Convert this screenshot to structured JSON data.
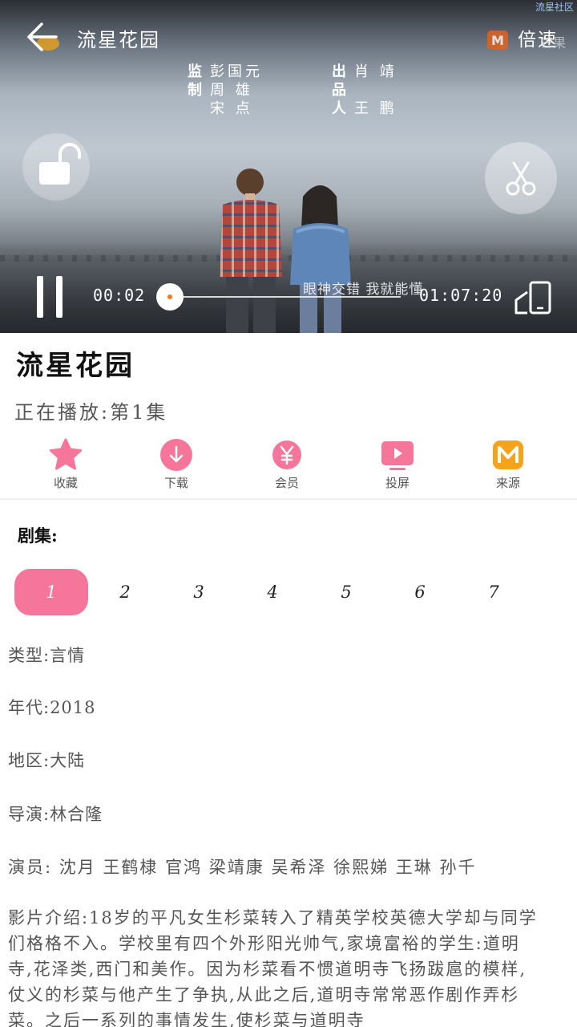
{
  "watermark": "流星社区",
  "player": {
    "title": "流星花园",
    "speed_label": "倍速",
    "logo_text": "芒果",
    "credits_left_role": [
      "监",
      "制"
    ],
    "credits_left_names": [
      "彭国元",
      "周  雄",
      "宋  点"
    ],
    "credits_right_role": [
      "出",
      "品",
      "人"
    ],
    "credits_right_names": [
      "肖  靖",
      "",
      "王  鹏"
    ],
    "current_time": "00:02",
    "total_time": "01:07:20",
    "subtitle": "眼神交错    我就能懂",
    "progress": 0
  },
  "show": {
    "title": "流星花园",
    "now_playing": "正在播放:第1集"
  },
  "actions": {
    "collect": "收藏",
    "download": "下载",
    "vip": "会员",
    "cast": "投屏",
    "source": "来源"
  },
  "episodes": {
    "label": "剧集:",
    "items": [
      "1",
      "2",
      "3",
      "4",
      "5",
      "6",
      "7"
    ],
    "active": "1"
  },
  "details": {
    "type": "类型:言情",
    "year": "年代:2018",
    "region": "地区:大陆",
    "director": "导演:林合隆",
    "cast": "演员: 沈月 王鹤棣 官鸿 梁靖康 吴希泽 徐熙娣 王琳 孙千",
    "synopsis": "影片介绍:18岁的平凡女生杉菜转入了精英学校英德大学却与同学们格格不入。学校里有四个外形阳光帅气,家境富裕的学生:道明寺,花泽类,西门和美作。因为杉菜看不惯道明寺飞扬跋扈的模样,仗义的杉菜与他产生了争执,从此之后,道明寺常常恶作剧作弄杉菜。之后一系列的事情发生,使杉菜与道明寺"
  },
  "colors": {
    "accent_pink": "#f5769a",
    "mango_orange": "#f7a21b",
    "progress_dot": "#f07c21"
  }
}
